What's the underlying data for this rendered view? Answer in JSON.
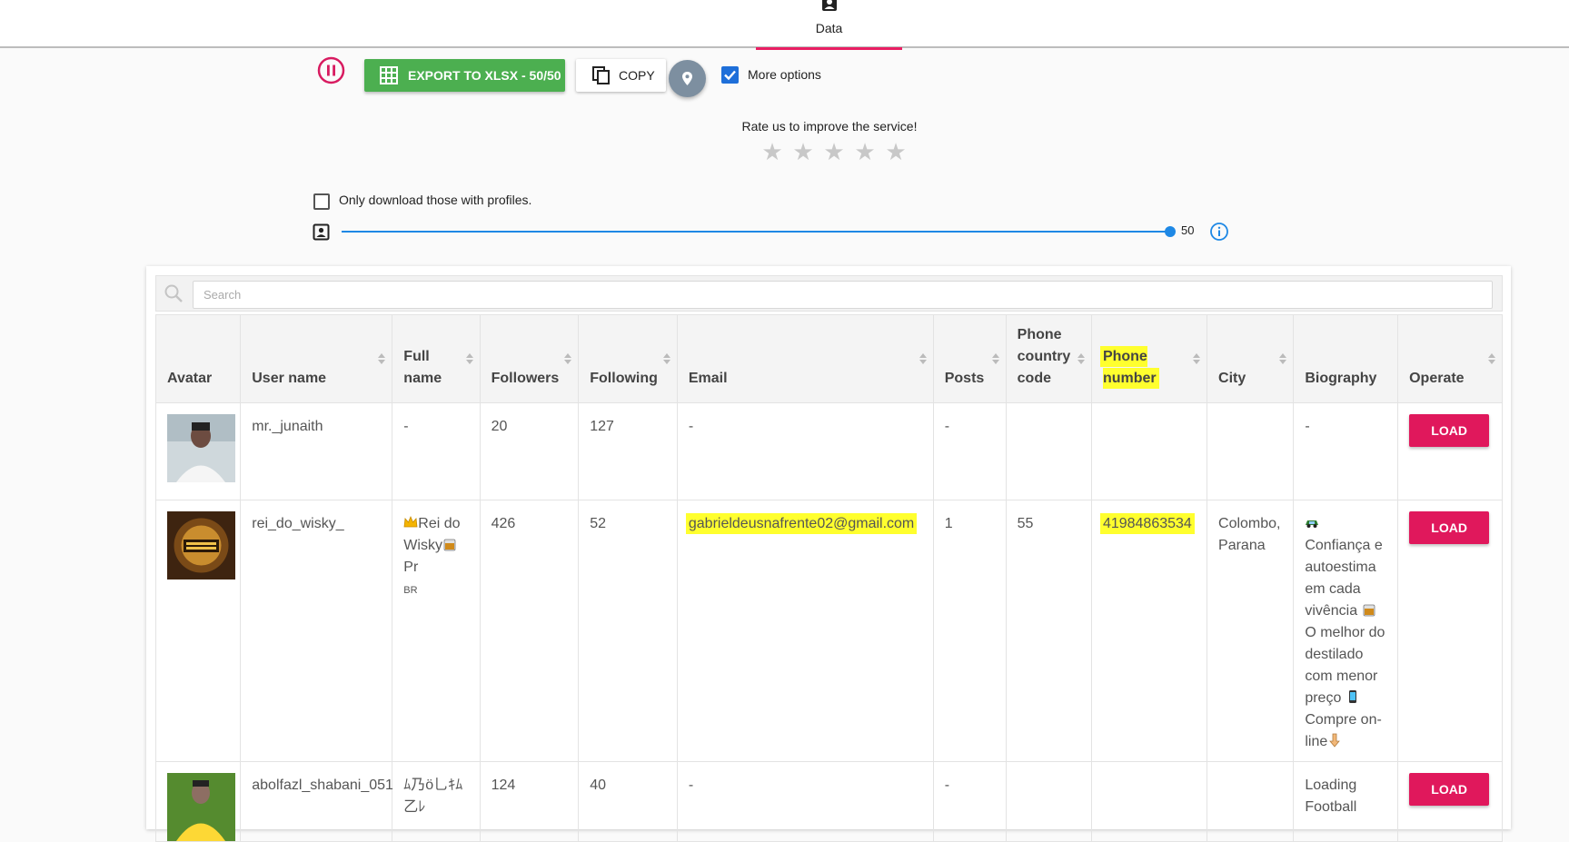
{
  "tab": {
    "label": "Data"
  },
  "toolbar": {
    "export_label": "EXPORT TO XLSX - 50/50",
    "copy_label": "COPY",
    "more_options_label": "More options",
    "more_options_checked": true
  },
  "rating": {
    "prompt": "Rate us to improve the service!",
    "stars": [
      "★",
      "★",
      "★",
      "★",
      "★"
    ]
  },
  "filter": {
    "only_profiles_label": "Only download those with profiles.",
    "only_profiles_checked": false
  },
  "slider": {
    "value": "50",
    "max": 50
  },
  "search": {
    "placeholder": "Search",
    "value": ""
  },
  "table": {
    "columns": [
      "Avatar",
      "User name",
      "Full name",
      "Followers",
      "Following",
      "Email",
      "Posts",
      "Phone country code",
      "Phone number",
      "City",
      "Biography",
      "Operate"
    ],
    "load_label": "LOAD",
    "rows": [
      {
        "username": "mr._junaith",
        "fullname": "-",
        "followers": "20",
        "following": "127",
        "email": "-",
        "posts": "-",
        "country_code": "",
        "phone": "",
        "city": "",
        "bio": "-"
      },
      {
        "username": "rei_do_wisky_",
        "fullname_a": "Rei do Wisky",
        "fullname_b": "Pr",
        "fullname_c": "BR",
        "followers": "426",
        "following": "52",
        "email": "gabrieldeusnafrente02@gmail.com",
        "posts": "1",
        "country_code": "55",
        "phone": "41984863534",
        "city": "Colombo, Parana",
        "bio_a": "Confiança e autoestima em cada vivência",
        "bio_b": "O melhor do destilado com menor preço",
        "bio_c": "Compre on-line"
      },
      {
        "username": "abolfazl_shabani_051",
        "fullname": "ﾑ乃ö乚ｷﾑ乙ﾚ",
        "followers": "124",
        "following": "40",
        "email": "-",
        "posts": "-",
        "country_code": "",
        "phone": "",
        "city": "",
        "bio": "Loading Football"
      }
    ]
  },
  "colors": {
    "accent": "#e91e63",
    "export_green": "#4caf50",
    "load_pink": "#e0185c",
    "highlight": "#ffff2e",
    "slider_blue": "#1e88e5"
  }
}
